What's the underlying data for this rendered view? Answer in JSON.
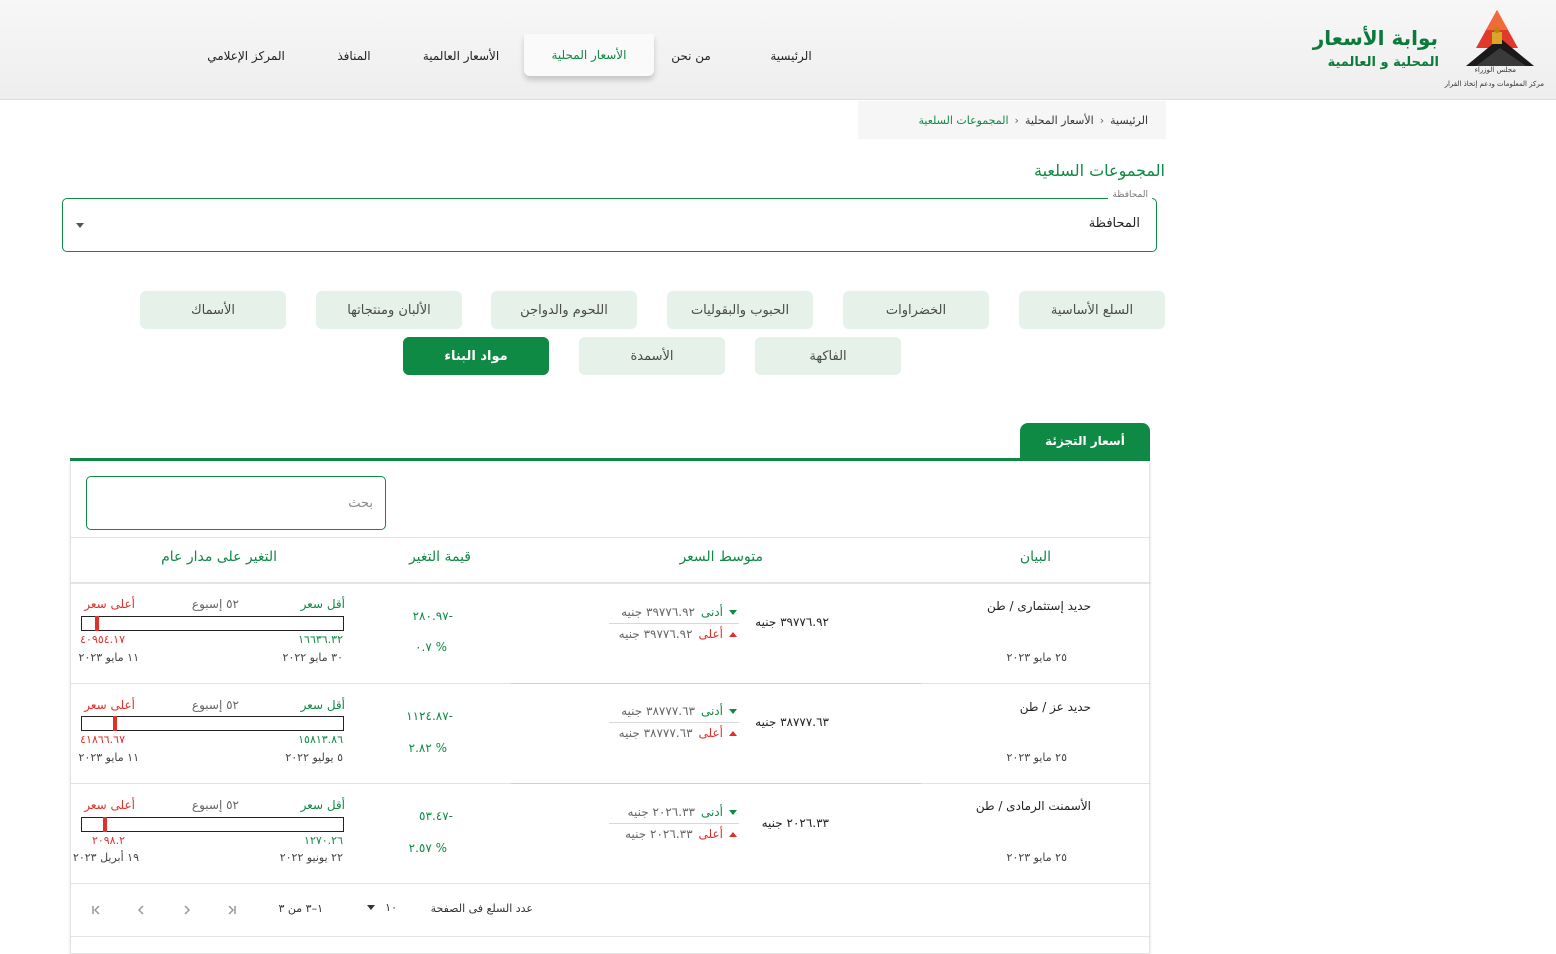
{
  "header": {
    "logo_title": "بوابة الأسعار",
    "logo_subtitle": "المحلية و العالمية",
    "emblem_caption": "مجلس الوزراء",
    "emblem_sub": "مركز المعلومات ودعم إتخاذ القرار",
    "nav": {
      "home": "الرئيسية",
      "about": "من نحن",
      "local_prices": "الأسعار المحلية",
      "global_prices": "الأسعار العالمية",
      "outlets": "المنافذ",
      "media_center": "المركز الإعلامي"
    }
  },
  "breadcrumb": {
    "home": "الرئيسية",
    "local": "الأسعار المحلية",
    "current": "المجموعات السلعية"
  },
  "page_title": "المجموعات السلعية",
  "governorate": {
    "float_label": "المحافظة",
    "value": "المحافظة"
  },
  "categories": {
    "basic": "السلع الأساسية",
    "vegetables": "الخضراوات",
    "grains": "الحبوب والبقوليات",
    "meat": "اللحوم والدواجن",
    "dairy": "الألبان ومنتجاتها",
    "fish": "الأسماك",
    "fruit": "الفاكهة",
    "fertilizers": "الأسمدة",
    "building": "مواد البناء"
  },
  "tab_retail": "أسعار التجزئة",
  "search_placeholder": "بحث",
  "columns": {
    "item": "البيان",
    "avg_price": "متوسط السعر",
    "change_value": "قيمة التغير",
    "year_change": "التغير على مدار عام"
  },
  "labels": {
    "min": "أدنى",
    "max": "أعلى",
    "lowest_price": "أقل سعر",
    "highest_price": "أعلى سعر",
    "weeks_52": "٥٢ إسبوع"
  },
  "rows": [
    {
      "name": "حديد إستثمارى / طن",
      "date": "٢٥ مايو ٢٠٢٣",
      "avg": "٣٩٧٧٦.٩٢ جنيه",
      "min": "٣٩٧٧٦.٩٢ جنيه",
      "max": "٣٩٧٧٦.٩٢ جنيه",
      "change_value": "٢٨٠.٩٧-",
      "change_pct": "٠.٧ %",
      "year_low": "١٦٦٣٦.٣٢",
      "year_high": "٤٠٩٥٤.١٧",
      "year_low_date": "٣٠ مايو ٢٠٢٢",
      "year_high_date": "١١ مايو ٢٠٢٣",
      "position_pct": 95
    },
    {
      "name": "حديد عز / طن",
      "date": "٢٥ مايو ٢٠٢٣",
      "avg": "٣٨٧٧٧.٦٣ جنيه",
      "min": "٣٨٧٧٧.٦٣ جنيه",
      "max": "٣٨٧٧٧.٦٣ جنيه",
      "change_value": "١١٢٤.٨٧-",
      "change_pct": "٢.٨٢ %",
      "year_low": "١٥٨١٣.٨٦",
      "year_high": "٤١٨٦٦.٦٧",
      "year_low_date": "٥ يوليو ٢٠٢٢",
      "year_high_date": "١١ مايو ٢٠٢٣",
      "position_pct": 88
    },
    {
      "name": "الأسمنت الرمادى / طن",
      "date": "٢٥ مايو ٢٠٢٣",
      "avg": "٢٠٢٦.٣٣ جنيه",
      "min": "٢٠٢٦.٣٣ جنيه",
      "max": "٢٠٢٦.٣٣ جنيه",
      "change_value": "٥٣.٤٧-",
      "change_pct": "٢.٥٧ %",
      "year_low": "١٢٧٠.٢٦",
      "year_high": "٢٠٩٨.٢",
      "year_low_date": "٢٢ يونيو ٢٠٢٢",
      "year_high_date": "١٩ أبريل ٢٠٢٣",
      "position_pct": 92
    }
  ],
  "paginator": {
    "items_per_page_label": "عدد السلع فى الصفحة",
    "page_size": "١٠",
    "range": "١–٣ من ٣"
  },
  "colors": {
    "brand_green": "#0f8a45",
    "chip_bg": "#e6f1ea",
    "high_red": "#e0302a"
  }
}
